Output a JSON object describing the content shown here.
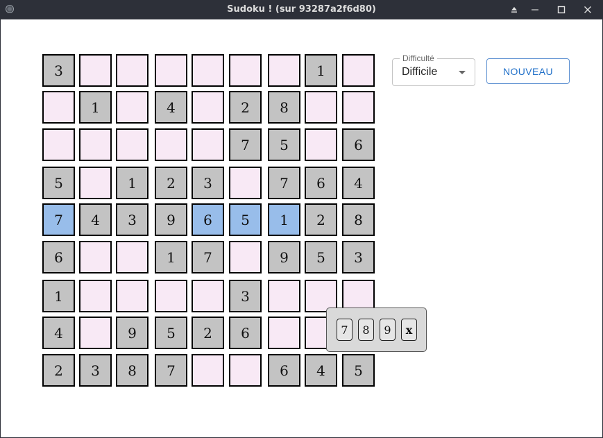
{
  "window": {
    "title": "Sudoku ! (sur 93287a2f6d80)",
    "app_icon": "app-icon",
    "controls": [
      "eject-icon",
      "minimize-icon",
      "maximize-icon",
      "close-icon"
    ]
  },
  "grid": {
    "rows": [
      [
        "3",
        "",
        "",
        "",
        "",
        "",
        "",
        "1",
        ""
      ],
      [
        "",
        "1",
        "",
        "4",
        "",
        "2",
        "8",
        "",
        ""
      ],
      [
        "",
        "",
        "",
        "",
        "",
        "7",
        "5",
        "",
        "6"
      ],
      [
        "5",
        "",
        "1",
        "2",
        "3",
        "",
        "7",
        "6",
        "4"
      ],
      [
        "7",
        "4",
        "3",
        "9",
        "6",
        "5",
        "1",
        "2",
        "8"
      ],
      [
        "6",
        "",
        "",
        "1",
        "7",
        "",
        "9",
        "5",
        "3"
      ],
      [
        "1",
        "",
        "",
        "",
        "",
        "3",
        "",
        "",
        ""
      ],
      [
        "4",
        "",
        "9",
        "5",
        "2",
        "6",
        "",
        "",
        ""
      ],
      [
        "2",
        "3",
        "8",
        "7",
        "",
        "",
        "6",
        "4",
        "5"
      ]
    ],
    "highlighted_cells": [
      [
        4,
        0
      ],
      [
        4,
        4
      ],
      [
        4,
        5
      ],
      [
        4,
        6
      ]
    ],
    "colors": {
      "given": "#c3c3c3",
      "empty": "#f8e9f5",
      "highlight": "#98bdea"
    }
  },
  "difficulty": {
    "label": "Difficulté",
    "value": "Difficile"
  },
  "new_button": {
    "label": "NOUVEAU"
  },
  "number_picker": {
    "options": [
      "7",
      "8",
      "9",
      "x"
    ]
  }
}
